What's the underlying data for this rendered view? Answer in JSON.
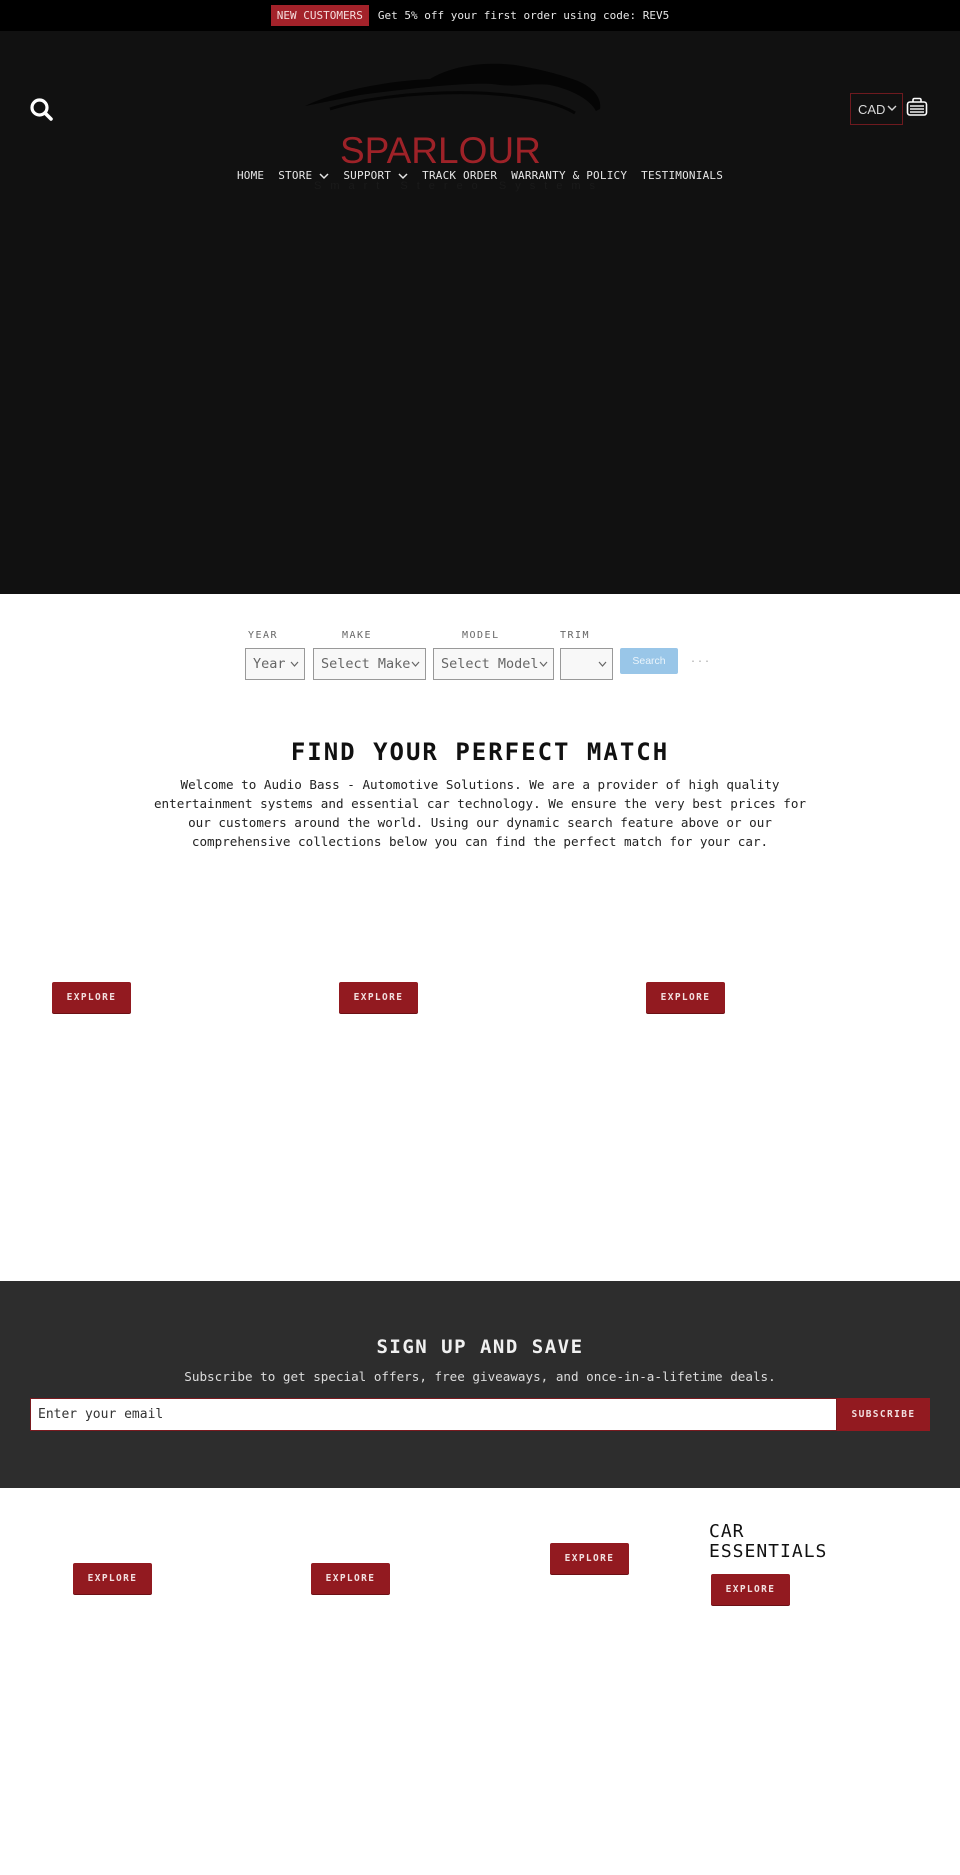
{
  "announcement": {
    "badge": "NEW CUSTOMERS",
    "message": "Get 5% off your first order using code: REV5"
  },
  "header": {
    "logo": {
      "brand": "SPARLOUR",
      "tagline": "Smart Stereo Systems."
    },
    "currency": {
      "selected": "CAD"
    },
    "icons": {
      "search": "search-icon",
      "cart": "cart-icon",
      "chevron": "chevron-down-icon"
    }
  },
  "nav": {
    "items": [
      {
        "label": "HOME",
        "has_dropdown": false
      },
      {
        "label": "STORE",
        "has_dropdown": true
      },
      {
        "label": "SUPPORT",
        "has_dropdown": true
      },
      {
        "label": "TRACK ORDER",
        "has_dropdown": false
      },
      {
        "label": "WARRANTY & POLICY",
        "has_dropdown": false
      },
      {
        "label": "TESTIMONIALS",
        "has_dropdown": false
      }
    ]
  },
  "vehicle_search": {
    "labels": {
      "year": "YEAR",
      "make": "MAKE",
      "model": "MODEL",
      "trim": "TRIM"
    },
    "selects": {
      "year": "Year",
      "make": "Select Make",
      "model": "Select Model",
      "trim": ""
    },
    "search_label": "Search",
    "more_label": "..."
  },
  "intro": {
    "title": "FIND YOUR PERFECT MATCH",
    "body": "Welcome to Audio Bass - Automotive Solutions. We are a provider of high quality entertainment systems and essential car technology. We ensure the very best prices for our customers around the world. Using our dynamic search feature above or our comprehensive collections below you can find the perfect match for your car."
  },
  "collections_top": [
    {
      "button": "EXPLORE"
    },
    {
      "button": "EXPLORE"
    },
    {
      "button": "EXPLORE"
    }
  ],
  "newsletter": {
    "title": "SIGN UP AND SAVE",
    "subtitle": "Subscribe to get special offers, free giveaways, and once-in-a-lifetime deals.",
    "email_placeholder": "Enter your email",
    "subscribe_label": "SUBSCRIBE"
  },
  "collections_bottom": [
    {
      "title": "",
      "button": "EXPLORE"
    },
    {
      "title": "",
      "button": "EXPLORE"
    },
    {
      "title": "",
      "button": "EXPLORE"
    },
    {
      "title": "CAR ESSENTIALS",
      "button": "EXPLORE"
    }
  ],
  "colors": {
    "brand_red": "#921a20",
    "header_bg": "#111111",
    "announcement_bg": "#000000",
    "newsletter_bg": "#2d2d2d",
    "search_button": "#99c6e8"
  }
}
